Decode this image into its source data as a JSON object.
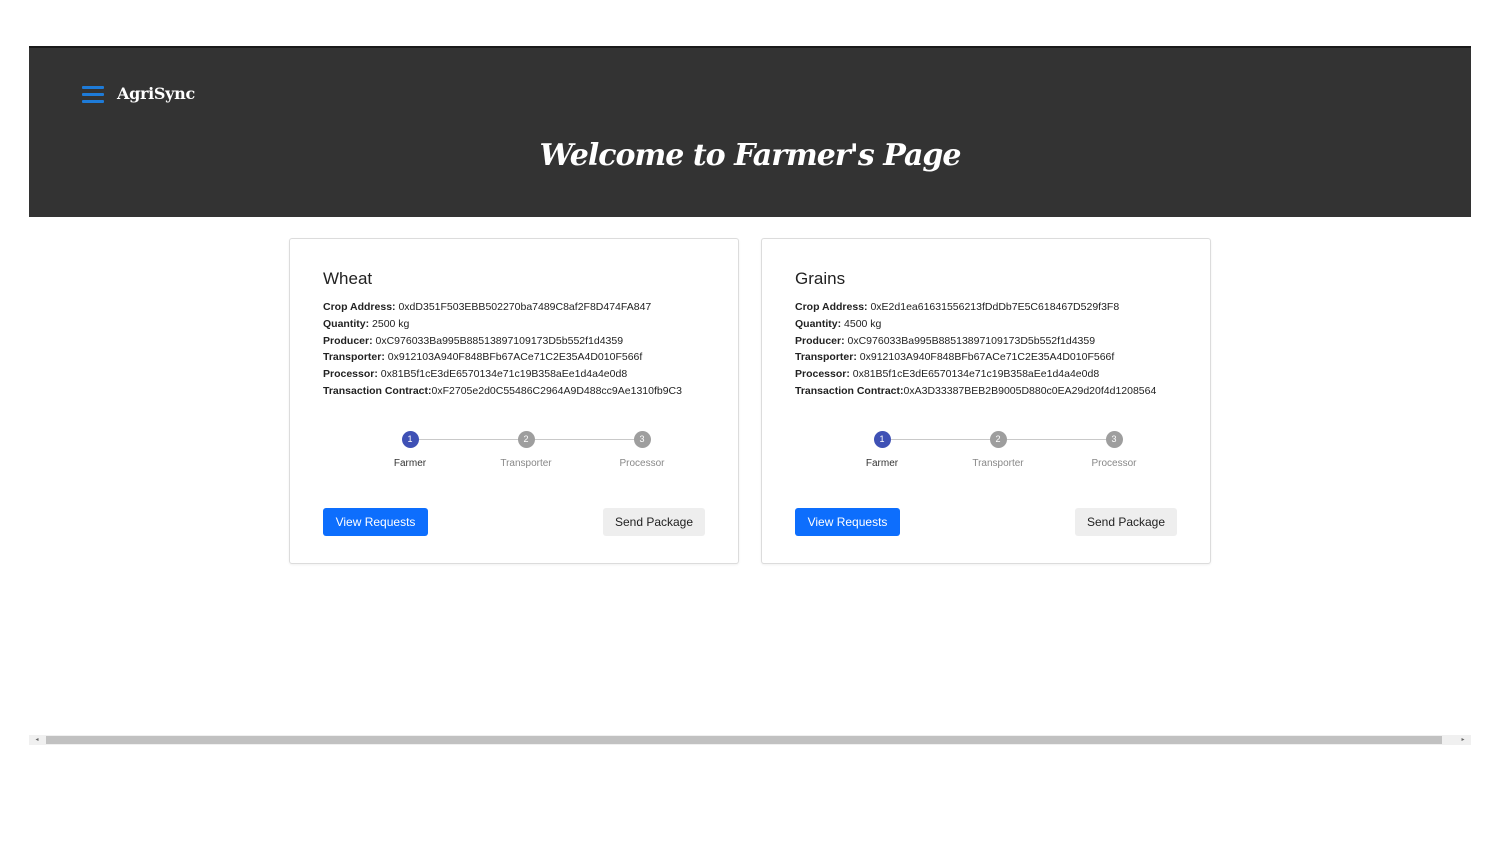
{
  "navbar": {
    "brand": "AgriSync",
    "menu_icon": "hamburger-menu-icon",
    "accent_color": "#1e7bd8",
    "background_color": "#333333"
  },
  "header": {
    "title": "Welcome to Farmer's Page"
  },
  "cards": [
    {
      "title": "Wheat",
      "fields": [
        {
          "label": "Crop Address:",
          "value": " 0xdD351F503EBB502270ba7489C8af2F8D474FA847"
        },
        {
          "label": "Quantity:",
          "value": " 2500 kg"
        },
        {
          "label": "Producer:",
          "value": " 0xC976033Ba995B88513897109173D5b552f1d4359"
        },
        {
          "label": "Transporter:",
          "value": " 0x912103A940F848BFb67ACe71C2E35A4D010F566f"
        },
        {
          "label": "Processor:",
          "value": " 0x81B5f1cE3dE6570134e71c19B358aEe1d4a4e0d8"
        },
        {
          "label": "Transaction Contract:",
          "value": "0xF2705e2d0C55486C2964A9D488cc9Ae1310fb9C3"
        }
      ],
      "steps": [
        {
          "number": "1",
          "label": "Farmer",
          "active": true
        },
        {
          "number": "2",
          "label": "Transporter",
          "active": false
        },
        {
          "number": "3",
          "label": "Processor",
          "active": false
        }
      ],
      "primary_button": "View Requests",
      "secondary_button": "Send Package"
    },
    {
      "title": "Grains",
      "fields": [
        {
          "label": "Crop Address:",
          "value": " 0xE2d1ea61631556213fDdDb7E5C618467D529f3F8"
        },
        {
          "label": "Quantity:",
          "value": " 4500 kg"
        },
        {
          "label": "Producer:",
          "value": " 0xC976033Ba995B88513897109173D5b552f1d4359"
        },
        {
          "label": "Transporter:",
          "value": " 0x912103A940F848BFb67ACe71C2E35A4D010F566f"
        },
        {
          "label": "Processor:",
          "value": " 0x81B5f1cE3dE6570134e71c19B358aEe1d4a4e0d8"
        },
        {
          "label": "Transaction Contract:",
          "value": "0xA3D33387BEB2B9005D880c0EA29d20f4d1208564"
        }
      ],
      "steps": [
        {
          "number": "1",
          "label": "Farmer",
          "active": true
        },
        {
          "number": "2",
          "label": "Transporter",
          "active": false
        },
        {
          "number": "3",
          "label": "Processor",
          "active": false
        }
      ],
      "primary_button": "View Requests",
      "secondary_button": "Send Package"
    }
  ],
  "colors": {
    "primary_button": "#0d6efd",
    "active_step": "#3f51b5",
    "inactive_step": "#9e9e9e"
  },
  "scrollbar": {
    "left_arrow": "◂",
    "right_arrow": "▸"
  }
}
